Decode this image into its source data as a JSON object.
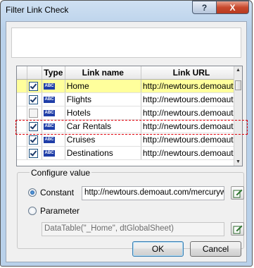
{
  "window": {
    "title": "Filter Link Check",
    "help_glyph": "?",
    "close_glyph": "X"
  },
  "table": {
    "columns": [
      "Type",
      "Link name",
      "Link URL"
    ],
    "type_icon_text": "ABC",
    "rows": [
      {
        "checked": true,
        "highlighted": true,
        "name": "Home",
        "url": "http://newtours.demoaut.c"
      },
      {
        "checked": true,
        "highlighted": false,
        "name": "Flights",
        "url": "http://newtours.demoaut."
      },
      {
        "checked": false,
        "highlighted": false,
        "name": "Hotels",
        "url": "http://newtours.demoaut."
      },
      {
        "checked": true,
        "highlighted": false,
        "name": "Car Rentals",
        "url": "http://newtours.demoaut."
      },
      {
        "checked": true,
        "highlighted": false,
        "name": "Cruises",
        "url": "http://newtours.demoaut."
      },
      {
        "checked": true,
        "highlighted": false,
        "name": "Destinations",
        "url": "http://newtours.demoaut."
      }
    ]
  },
  "configure": {
    "group_label": "Configure value",
    "constant_label": "Constant",
    "constant_value": "http://newtours.demoaut.com/mercuryw",
    "parameter_label": "Parameter",
    "parameter_value": "DataTable(\"_Home\", dtGlobalSheet)",
    "selected": "constant"
  },
  "buttons": {
    "ok": "OK",
    "cancel": "Cancel"
  },
  "colors": {
    "highlight_row": "#ffff9c",
    "selection_outline": "#e0000a"
  }
}
